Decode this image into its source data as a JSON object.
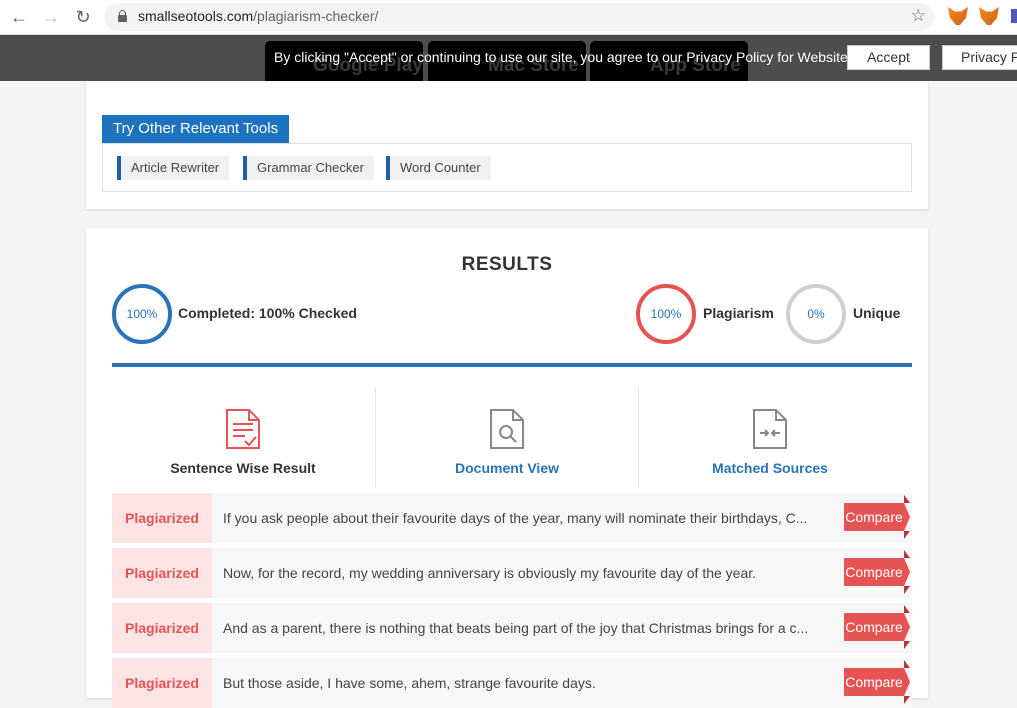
{
  "browser": {
    "url_domain": "smallseotools.com",
    "url_path": "/plagiarism-checker/"
  },
  "cookie_bar": {
    "message": "By clicking \"Accept\" or continuing to use our site, you agree to our Privacy Policy for Website",
    "accept_label": "Accept",
    "privacy_label": "Privacy P",
    "stores": [
      "Google Play",
      "Mac Store",
      "App Store"
    ]
  },
  "tools": {
    "title": "Try Other Relevant Tools",
    "items": [
      "Article Rewriter",
      "Grammar Checker",
      "Word Counter"
    ]
  },
  "results": {
    "title": "RESULTS",
    "completed": {
      "value": "100%",
      "label": "Completed: 100% Checked"
    },
    "plagiarism": {
      "value": "100%",
      "label": "Plagiarism"
    },
    "unique": {
      "value": "0%",
      "label": "Unique"
    },
    "views": [
      {
        "label": "Sentence Wise Result",
        "color": "#333333"
      },
      {
        "label": "Document View",
        "color": "#2a73b8"
      },
      {
        "label": "Matched Sources",
        "color": "#2a73b8"
      }
    ],
    "rows": [
      {
        "tag": "Plagiarized",
        "text": "If you ask people about their favourite days of the year, many will nominate their birthdays, C...",
        "action": "Compare"
      },
      {
        "tag": "Plagiarized",
        "text": "Now, for the record, my wedding anniversary is obviously my favourite day of the year.",
        "action": "Compare"
      },
      {
        "tag": "Plagiarized",
        "text": "And as a parent, there is nothing that beats being part of the joy that Christmas brings for a c...",
        "action": "Compare"
      },
      {
        "tag": "Plagiarized",
        "text": "But those aside, I have some, ahem, strange favourite days.",
        "action": "Compare"
      }
    ]
  },
  "colors": {
    "brand_blue": "#1e73be",
    "plagiarism_red": "#e55353"
  }
}
